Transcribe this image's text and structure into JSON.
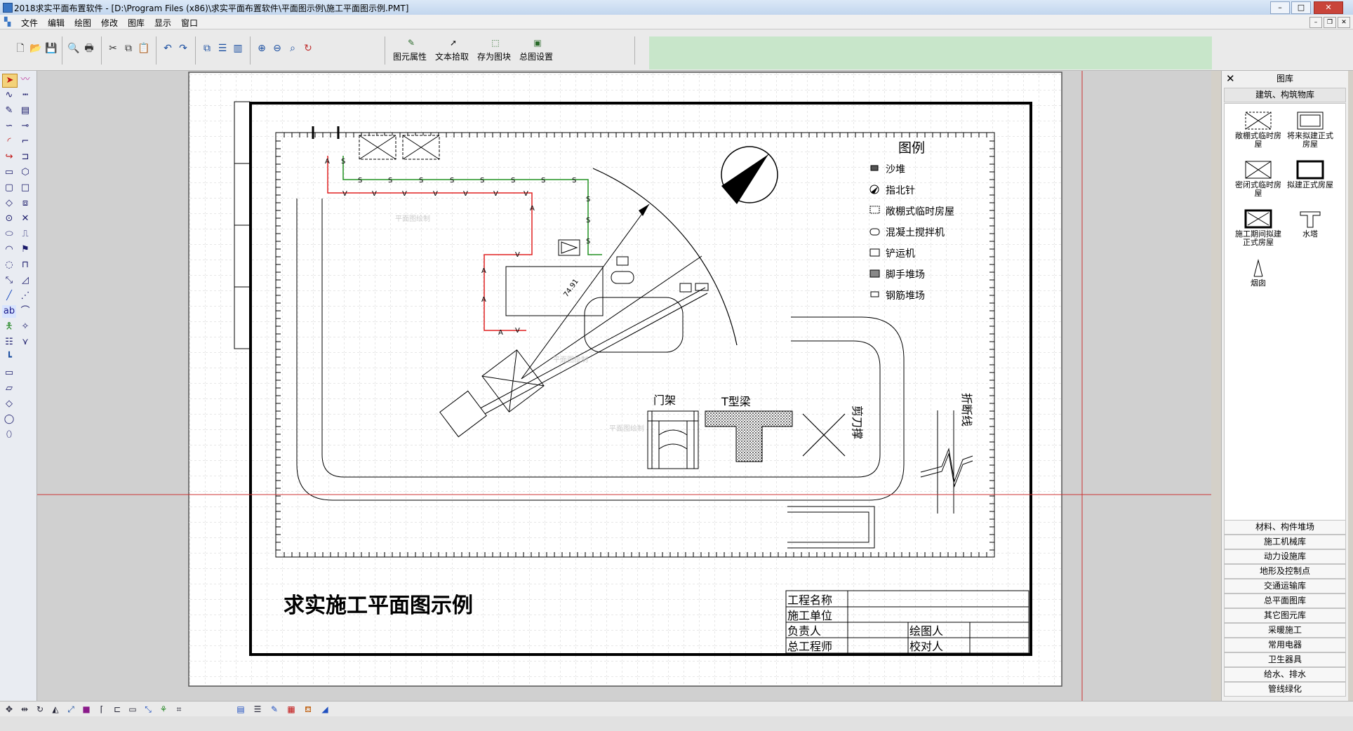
{
  "window": {
    "title": "2018求实平面布置软件 - [D:\\Program Files (x86)\\求实平面布置软件\\平面图示例\\施工平面图示例.PMT]",
    "minimize": "–",
    "maximize": "□",
    "close": "✕"
  },
  "menu": {
    "items": [
      "文件",
      "编辑",
      "绘图",
      "修改",
      "图库",
      "显示",
      "窗口"
    ],
    "mdi_min": "–",
    "mdi_restore": "❐",
    "mdi_close": "✕"
  },
  "toolbar": {
    "icons": [
      "new-file-icon",
      "open-folder-icon",
      "save-icon",
      "print-preview-icon",
      "print-icon",
      "cut-icon",
      "copy-icon",
      "paste-icon",
      "undo-icon",
      "redo-icon",
      "layer-front-icon",
      "layer-middle-icon",
      "layer-back-icon",
      "zoom-in-icon",
      "zoom-out-icon",
      "zoom-window-icon",
      "zoom-refresh-icon"
    ],
    "labeled_buttons": [
      {
        "label": "图元属性",
        "icon": "element-properties-icon"
      },
      {
        "label": "文本拾取",
        "icon": "text-pick-icon"
      },
      {
        "label": "存为图块",
        "icon": "save-block-icon"
      },
      {
        "label": "总图设置",
        "icon": "plan-settings-icon"
      }
    ],
    "panel_color": "#c8e6ca"
  },
  "drawing": {
    "title": "求实施工平面图示例",
    "watermark": "平面图绘制",
    "legend": {
      "heading": "图例",
      "items": [
        "沙堆",
        "指北针",
        "敞棚式临时房屋",
        "混凝土搅拌机",
        "铲运机",
        "脚手堆场",
        "钢筋堆场"
      ]
    },
    "symbols": {
      "gantry": "门架",
      "t_beam": "T型梁",
      "scissor_brace": "剪刀撑",
      "break_line": "折断线"
    },
    "dimension": "74.91",
    "pipe_marks": {
      "sewer": "S",
      "water": "V",
      "arrow": "A"
    },
    "title_block": {
      "project_name": "工程名称",
      "construction_unit": "施工单位",
      "responsible": "负责人",
      "drawn_by": "绘图人",
      "chief_engineer": "总工程师",
      "checked_by": "校对人"
    }
  },
  "library": {
    "title": "图库",
    "close": "✕",
    "active_category": "建筑、构筑物库",
    "items": [
      "敞棚式临时房屋",
      "将来拟建正式房屋",
      "密闭式临时房屋",
      "拟建正式房屋",
      "施工期间拟建正式房屋",
      "水塔",
      "烟囱"
    ],
    "categories": [
      "材料、构件堆场",
      "施工机械库",
      "动力设施库",
      "地形及控制点",
      "交通运输库",
      "总平面图库",
      "其它图元库",
      "采暖施工",
      "常用电器",
      "卫生器具",
      "给水、排水",
      "管线绿化"
    ]
  },
  "colors": {
    "red_line": "#e02020",
    "green_line": "#209020",
    "crosshair": "#cc3333",
    "grid": "#cfcfcf"
  }
}
